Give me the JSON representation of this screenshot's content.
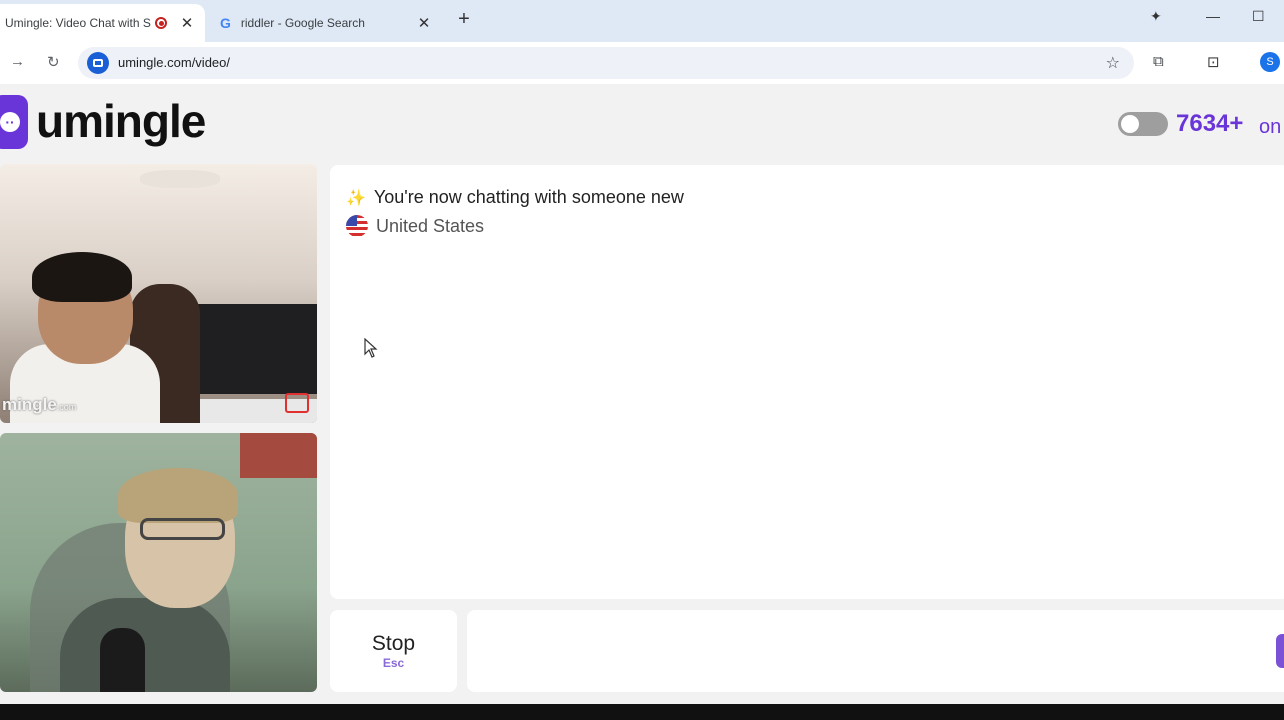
{
  "browser": {
    "tabs": [
      {
        "title": "Umingle: Video Chat with St",
        "active": true,
        "recording": true
      },
      {
        "title": "riddler - Google Search",
        "active": false,
        "icon": "google-icon"
      }
    ],
    "new_tab": "+",
    "url": "umingle.com/video/",
    "profile_initial": "S",
    "accent": "#1a73e8"
  },
  "site": {
    "logo_text": "umingle",
    "brand_color": "#6a35d8",
    "online_count": "7634+",
    "online_label": "on"
  },
  "remote_video": {
    "watermark": "mingle",
    "watermark_suffix": ".com"
  },
  "chat": {
    "status_message": "You're now chatting with someone new",
    "status_icon": "sparkle-icon",
    "country": "United States",
    "country_flag": "us-flag-icon"
  },
  "controls": {
    "stop_label": "Stop",
    "stop_shortcut": "Esc",
    "message_placeholder": ""
  }
}
